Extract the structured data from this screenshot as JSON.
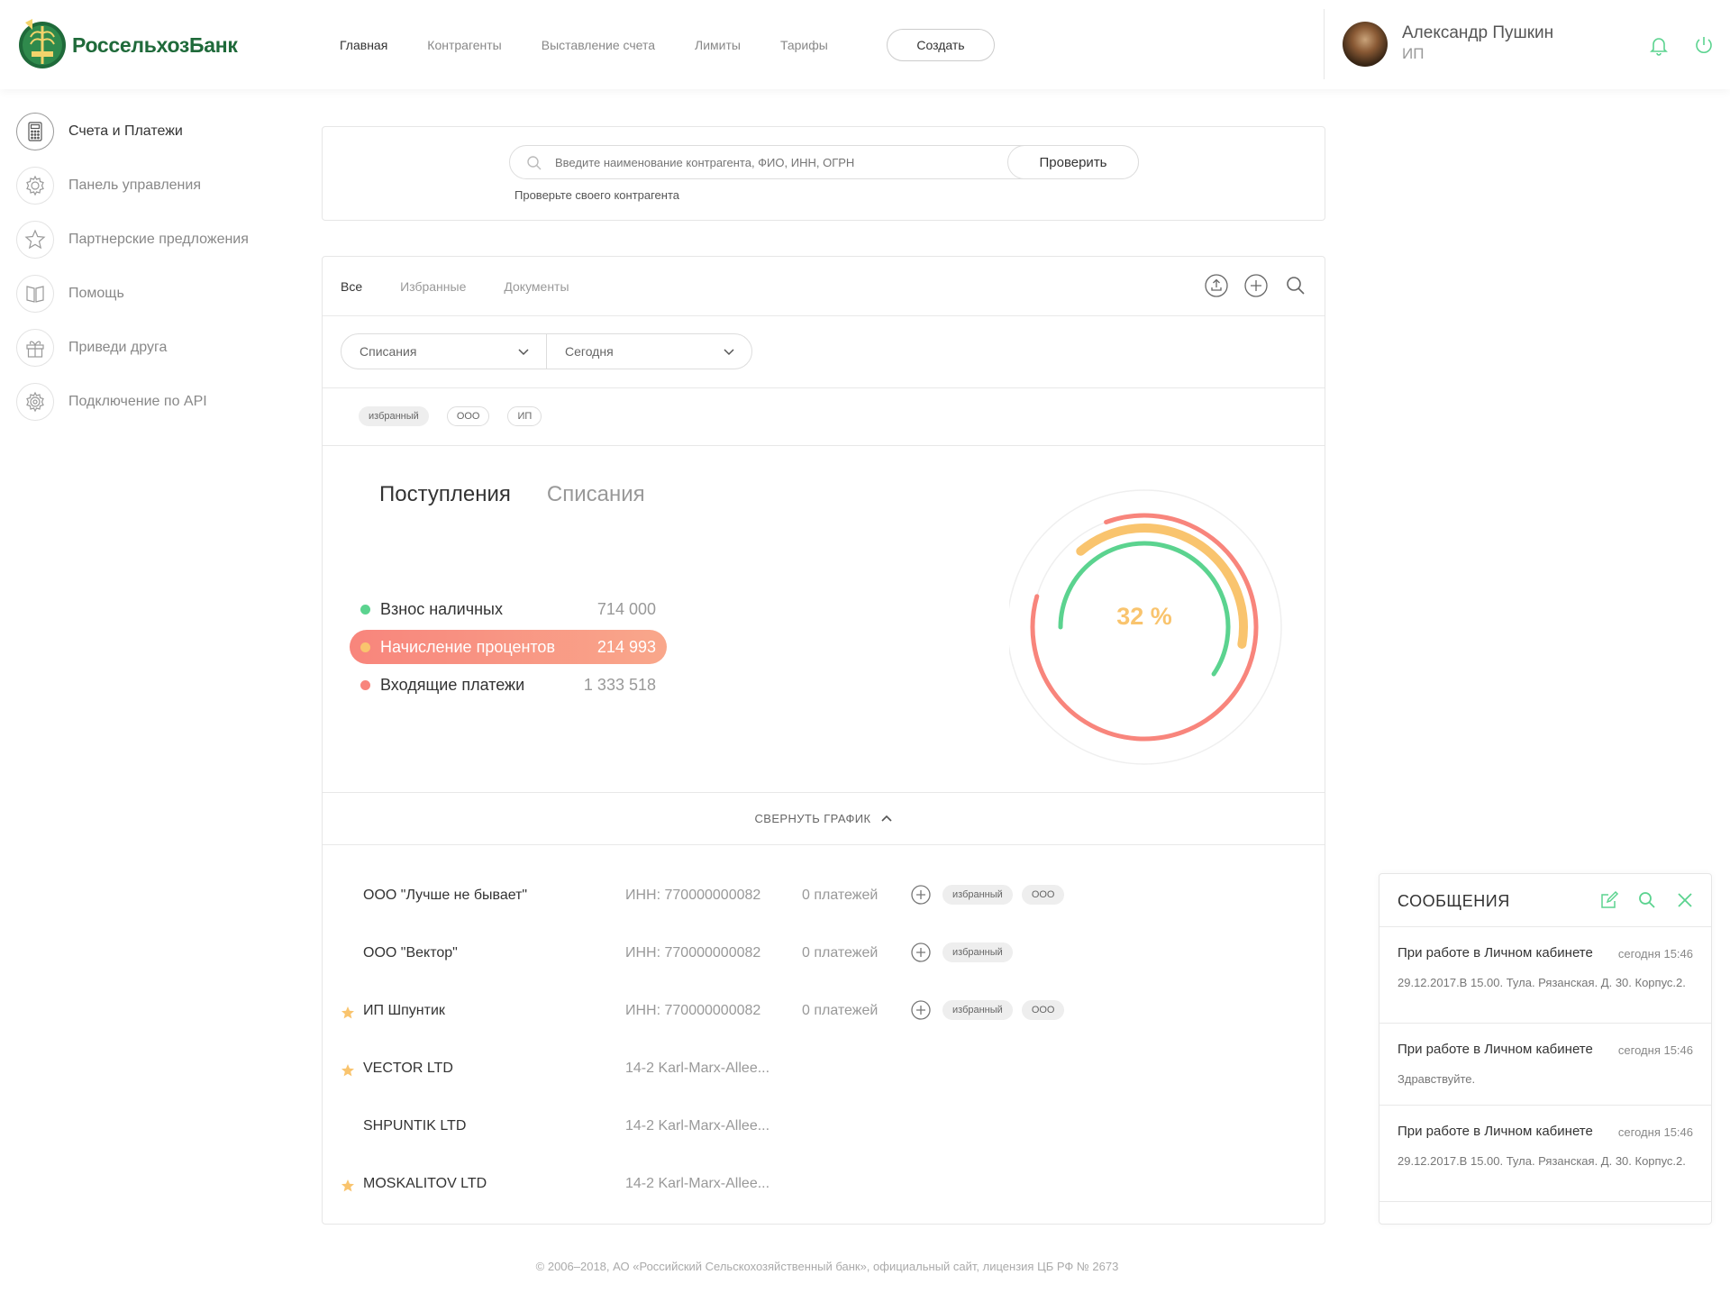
{
  "brand": {
    "name": "РоссельхозБанк",
    "accent": "#1f6a3a",
    "green": "#5bd38f"
  },
  "nav": {
    "items": [
      "Главная",
      "Контрагенты",
      "Выставление счета",
      "Лимиты",
      "Тарифы"
    ],
    "create_label": "Создать"
  },
  "user": {
    "name": "Александр Пушкин",
    "role": "ИП"
  },
  "sidebar": {
    "items": [
      {
        "label": "Счета и Платежи",
        "icon": "calculator-icon"
      },
      {
        "label": "Панель управления",
        "icon": "gear-icon"
      },
      {
        "label": "Партнерские предложения",
        "icon": "star-icon"
      },
      {
        "label": "Помощь",
        "icon": "book-icon"
      },
      {
        "label": "Приведи друга",
        "icon": "gift-icon"
      },
      {
        "label": "Подключение по API",
        "icon": "api-gear-icon"
      }
    ]
  },
  "search": {
    "placeholder": "Введите наименование контрагента, ФИО, ИНН, ОГРН",
    "button": "Проверить",
    "hint": "Проверьте своего контрагента"
  },
  "tabs": [
    "Все",
    "Избранные",
    "Документы"
  ],
  "filters": {
    "type": "Списания",
    "period": "Сегодня"
  },
  "chips": [
    "избранный",
    "ООО",
    "ИП"
  ],
  "chart_tabs": [
    "Поступления",
    "Списания"
  ],
  "chart_data": {
    "type": "donut",
    "center_label": "32 %",
    "series": [
      {
        "name": "Взнос наличных",
        "value": 714000,
        "value_text": "714 000",
        "color": "#5bd38f"
      },
      {
        "name": "Начисление процентов",
        "value": 214993,
        "value_text": "214 993",
        "color": "#f9c46e"
      },
      {
        "name": "Входящие платежи",
        "value": 1333518,
        "value_text": "1 333 518",
        "color": "#f8857c"
      }
    ]
  },
  "collapse_label": "СВЕРНУТЬ ГРАФИК",
  "rows": [
    {
      "name": "ООО \"Лучше не бывает\"",
      "inn": "ИНН: 770000000082",
      "payments": "0 платежей",
      "chips": [
        "избранный",
        "ООО"
      ],
      "starred": false
    },
    {
      "name": "ООО \"Вектор\"",
      "inn": "ИНН: 770000000082",
      "payments": "0 платежей",
      "chips": [
        "избранный"
      ],
      "starred": false
    },
    {
      "name": "ИП Шпунтик",
      "inn": "ИНН: 770000000082",
      "payments": "0 платежей",
      "chips": [
        "избранный",
        "ООО"
      ],
      "starred": true
    },
    {
      "name": "VECTOR LTD",
      "inn": "14-2 Karl-Marx-Allee...",
      "payments": "",
      "chips": [],
      "starred": true
    },
    {
      "name": "SHPUNTIK LTD",
      "inn": "14-2 Karl-Marx-Allee...",
      "payments": "",
      "chips": [],
      "starred": false
    },
    {
      "name": "MOSKALITOV LTD",
      "inn": "14-2 Karl-Marx-Allee...",
      "payments": "",
      "chips": [],
      "starred": true
    }
  ],
  "footer": "© 2006–2018, АО «Российский Сельскохозяйственный банк», официальный сайт, лицензия ЦБ РФ № 2673",
  "messages": {
    "title": "СООБЩЕНИЯ",
    "items": [
      {
        "subject": "При работе в Личном кабинете",
        "time": "сегодня 15:46",
        "body": "29.12.2017.В 15.00. Тула. Рязанская. Д. 30. Корпус.2."
      },
      {
        "subject": "При работе в Личном кабинете",
        "time": "сегодня 15:46",
        "body": "Здравствуйте."
      },
      {
        "subject": "При работе в Личном кабинете",
        "time": "сегодня 15:46",
        "body": "29.12.2017.В 15.00. Тула. Рязанская. Д. 30. Корпус.2."
      }
    ]
  }
}
